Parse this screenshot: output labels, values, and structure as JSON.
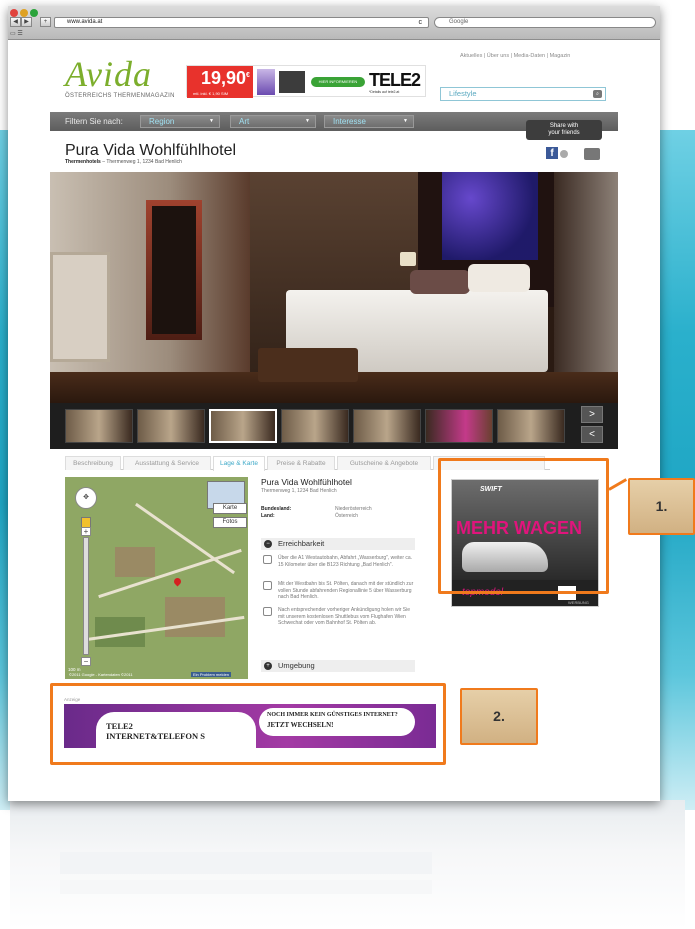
{
  "browser": {
    "url": "www.avida.at",
    "search_placeholder": "Google"
  },
  "header": {
    "logo": "Avida",
    "logo_sub": "ÖSTERREICHS THERMENMAGAZIN",
    "top_nav": "Aktuelles  |  Über uns  |  Media-Daten  |  Magazin",
    "search_value": "Lifestyle"
  },
  "banner_ad": {
    "price": "19,90",
    "price_sup": "€",
    "price_note": "mtl. inkl. € 1,90 SIM",
    "button": "HIER INFORMIEREN",
    "brand": "TELE2",
    "brand_sub": "*Details auf tele2.at"
  },
  "filter": {
    "label": "Filtern Sie nach:",
    "region": "Region",
    "art": "Art",
    "interesse": "Interesse"
  },
  "share": {
    "line1": "Share with",
    "line2": "your friends"
  },
  "hotel": {
    "title": "Pura Vida Wohlfühlhotel",
    "category": "Thermenhotels",
    "address": "Thermenweg 1, 1234 Bad Henlich",
    "name": "Pura Vida Wohlfühlhotel",
    "bundesland_label": "Bundesland:",
    "bundesland_value": "Niederösterreich",
    "land_label": "Land:",
    "land_value": "Österreich"
  },
  "gallery": {
    "next": ">",
    "prev": "<"
  },
  "tabs": [
    "Beschreibung",
    "Ausstattung & Service",
    "Lage & Karte",
    "Preise & Rabatte",
    "Gutscheine & Angebote"
  ],
  "map": {
    "karte": "Karte",
    "fotos": "Fotos",
    "scale": "100 m",
    "copyright": "©2011 Google - Kartendaten ©2011",
    "problem": "Ein Problem melden"
  },
  "access": {
    "heading": "Erreichbarkeit",
    "car": "Über die A1 Westautobahn, Abfahrt „Wasserburg\", weiter ca. 15 Kilometer über die B123 Richtung „Bad Henlich\".",
    "train": "Mit der Westbahn bis St. Pölten, danach mit der stündlich zur vollen Stunde abfahrenden Regionallinie 5 über Wasserburg nach Bad Henlich.",
    "bus": "Nach entsprechender vorheriger Ankündigung holen wir Sie mit unserem kostenlosen Shuttlebus vom Flughafen Wien Schwechat oder vom Bahnhof St. Pölten ab.",
    "surroundings": "Umgebung"
  },
  "ad_right": {
    "brand": "SWIFT",
    "headline": "MEHR WAGEN",
    "show": "topmodel",
    "maker": "SUZUKI",
    "tag": "WERBUNG"
  },
  "ad_bottom": {
    "label": "Anzeige",
    "line1": "TELE2",
    "line2": "INTERNET&TELEFON S",
    "line3": "NOCH IMMER KEIN GÜNSTIGES INTERNET?",
    "line4": "JETZT WECHSELN!"
  },
  "callouts": {
    "one": "1.",
    "two": "2."
  },
  "colors": {
    "highlight": "#f07a1c",
    "accent": "#3ea9c8",
    "logo_green": "#7cae2c"
  }
}
